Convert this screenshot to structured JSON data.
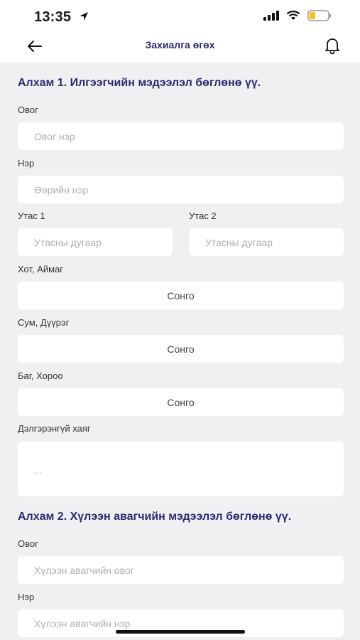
{
  "status_bar": {
    "time": "13:35",
    "icons": [
      "location-arrow-icon",
      "signal-icon",
      "wifi-icon",
      "battery-icon"
    ]
  },
  "nav": {
    "title": "Захиалга өгөх",
    "back_icon": "back-arrow-icon",
    "bell_icon": "bell-icon"
  },
  "step1": {
    "title": "Алхам 1. Илгээгчийн мэдээлэл бөглөнө үү.",
    "last_name_label": "Овог",
    "last_name_placeholder": "Овог нэр",
    "first_name_label": "Нэр",
    "first_name_placeholder": "Өөрийн нэр",
    "phone1_label": "Утас 1",
    "phone1_placeholder": "Утасны дугаар",
    "phone2_label": "Утас 2",
    "phone2_placeholder": "Утасны дугаар",
    "city_label": "Хот, Аймаг",
    "city_value": "Сонго",
    "district_label": "Сум, Дүүрэг",
    "district_value": "Сонго",
    "khoroo_label": "Баг, Хороо",
    "khoroo_value": "Сонго",
    "address_label": "Дэлгэрэнгүй хаяг",
    "address_placeholder": "..."
  },
  "step2": {
    "title": "Алхам 2. Хүлээн авагчийн мэдээлэл бөглөнө үү.",
    "last_name_label": "Овог",
    "last_name_placeholder": "Хүлээн авагчийн овог",
    "first_name_label": "Нэр",
    "first_name_placeholder": "Хүлээн авагчийн нэр"
  },
  "colors": {
    "accent": "#2d2a6e",
    "background": "#f0f0f2",
    "field": "#ffffff",
    "battery": "#f5c518"
  }
}
